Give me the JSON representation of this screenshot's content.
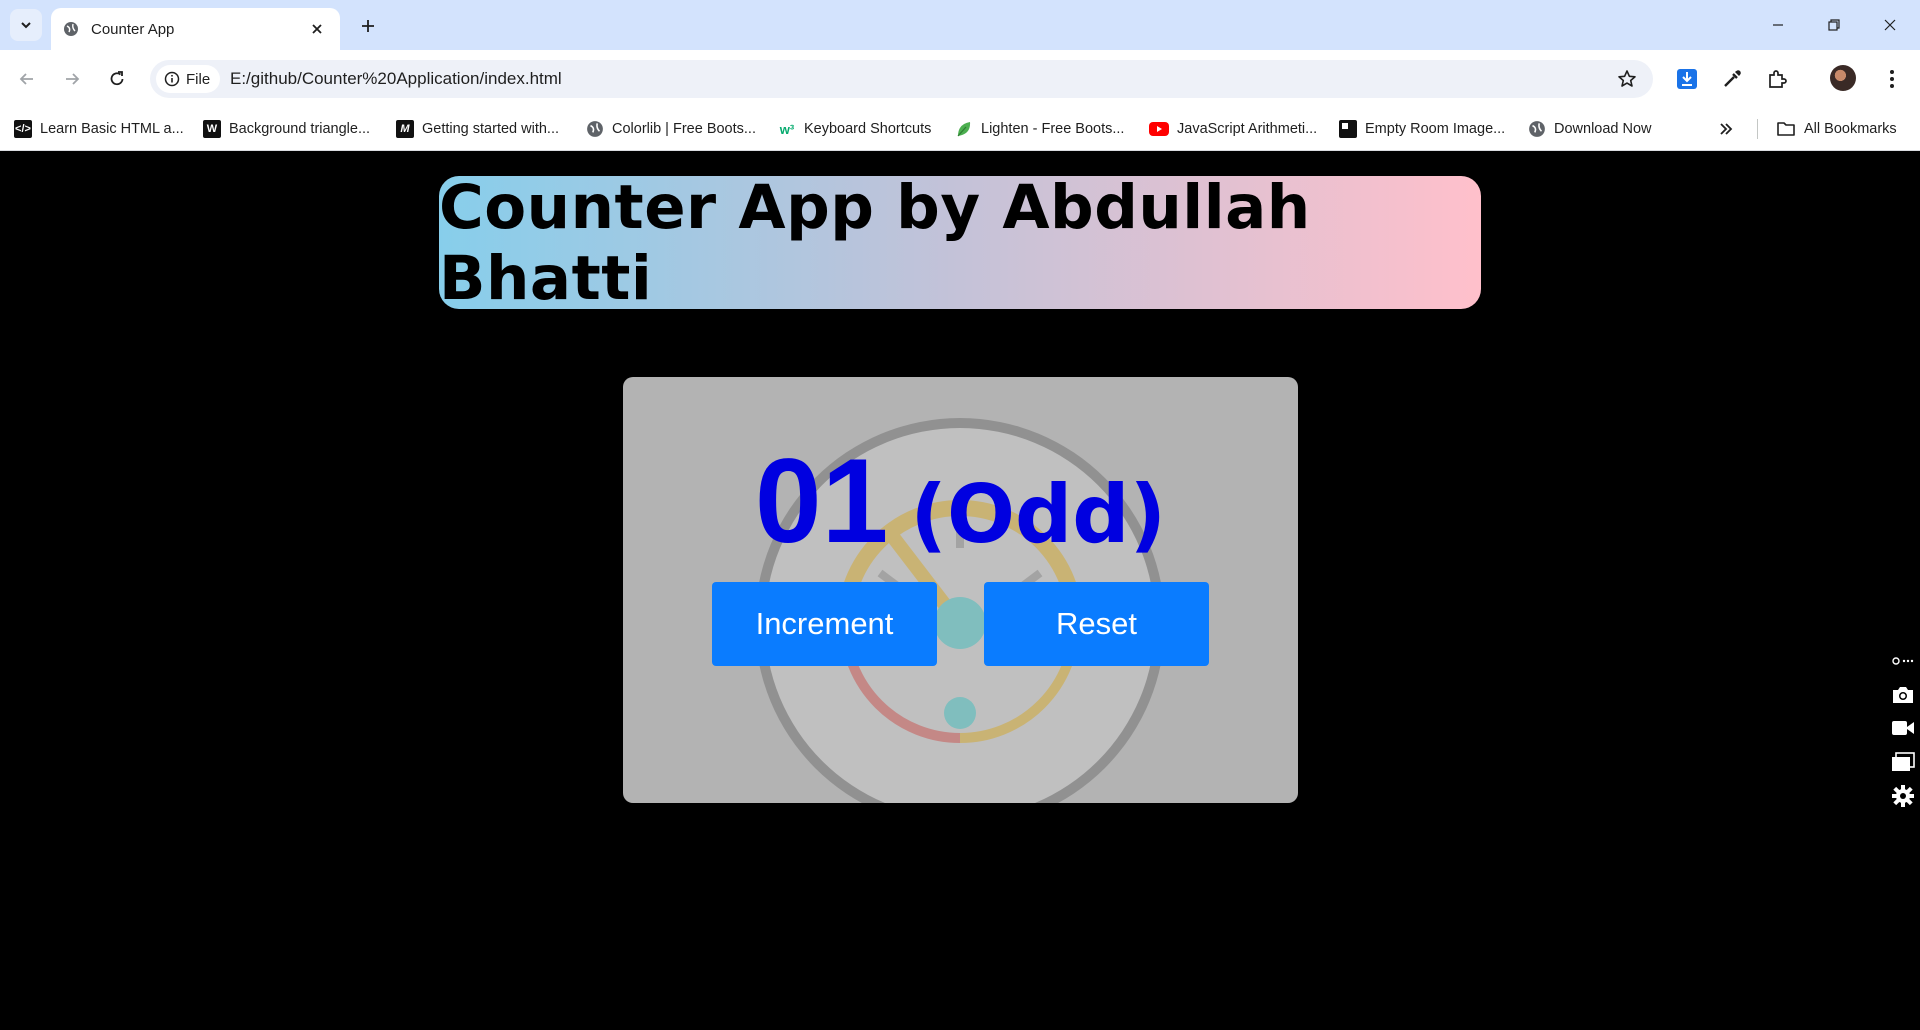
{
  "browser": {
    "tab_title": "Counter App",
    "site_chip_label": "File",
    "url": "E:/github/Counter%20Application/index.html",
    "all_bookmarks_label": "All Bookmarks",
    "bookmarks": [
      {
        "label": "Learn Basic HTML a...",
        "icon": "code-icon"
      },
      {
        "label": "Background triangle...",
        "icon": "w-logo-icon"
      },
      {
        "label": "Getting started with...",
        "icon": "m-logo-icon"
      },
      {
        "label": "Colorlib | Free Boots...",
        "icon": "globe-icon"
      },
      {
        "label": "Keyboard Shortcuts",
        "icon": "w3-logo-icon"
      },
      {
        "label": "Lighten - Free Boots...",
        "icon": "leaf-icon"
      },
      {
        "label": "JavaScript Arithmeti...",
        "icon": "youtube-icon"
      },
      {
        "label": "Empty Room Image...",
        "icon": "square-logo-icon"
      },
      {
        "label": "Download Now",
        "icon": "globe-icon"
      }
    ]
  },
  "app": {
    "title": "Counter App by Abdullah Bhatti",
    "count": "01",
    "parity": "(Odd)",
    "increment_label": "Increment",
    "reset_label": "Reset"
  },
  "colors": {
    "count_text": "#0000e0",
    "button_bg": "#0a7cff",
    "banner_gradient_start": "#87ceeb",
    "banner_gradient_end": "#ffc0cb",
    "card_bg": "#b3b3b3"
  }
}
